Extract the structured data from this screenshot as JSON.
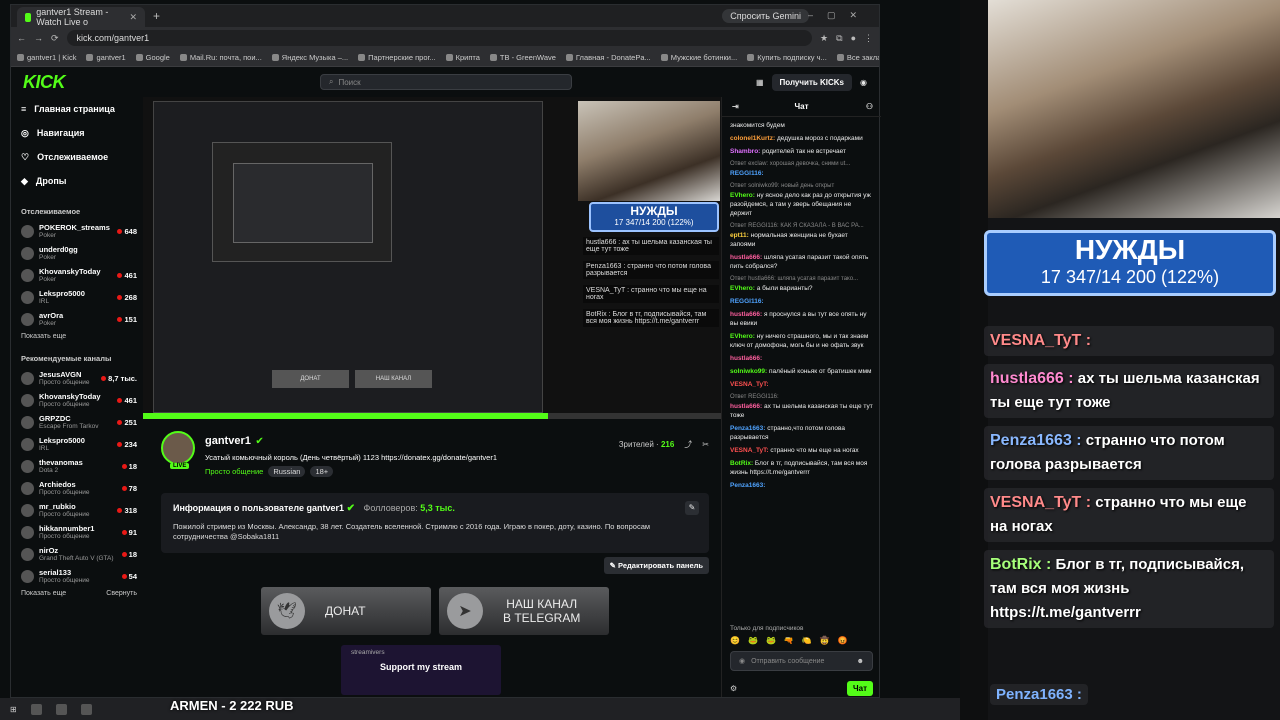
{
  "browser": {
    "tab_title": "gantver1 Stream - Watch Live o",
    "new_tab": "+",
    "gemini": "Спросить Gemini",
    "url": "kick.com/gantver1",
    "bookmarks": [
      "gantver1 | Kick",
      "gantver1",
      "Google",
      "Mail.Ru: почта, пои...",
      "Яндекс Музыка –...",
      "Партнерские прог...",
      "Крипта",
      "TB - GreenWave",
      "Главная - DonatePa...",
      "Мужские ботинки...",
      "Купить подписку ч...",
      "Все закладки"
    ]
  },
  "header": {
    "logo": "KICK",
    "search_placeholder": "Поиск",
    "get_kicks": "Получить KICKs"
  },
  "sidebar": {
    "nav": [
      {
        "label": "Главная страница",
        "icon": "hamburger-icon"
      },
      {
        "label": "Навигация",
        "icon": "compass-icon"
      },
      {
        "label": "Отслеживаемое",
        "icon": "heart-icon"
      },
      {
        "label": "Дропы",
        "icon": "drops-icon"
      }
    ],
    "following_title": "Отслеживаемое",
    "following": [
      {
        "name": "POKEROK_streams",
        "cat": "Poker",
        "viewers": "648"
      },
      {
        "name": "underd0gg",
        "cat": "Poker",
        "viewers": ""
      },
      {
        "name": "KhovanskyToday",
        "cat": "Poker",
        "viewers": "461"
      },
      {
        "name": "Lekspro5000",
        "cat": "IRL",
        "viewers": "268"
      },
      {
        "name": "avrOra",
        "cat": "Poker",
        "viewers": "151"
      }
    ],
    "show_more_1": "Показать еще",
    "recommended_title": "Рекомендуемые каналы",
    "recommended": [
      {
        "name": "JesusAVGN",
        "cat": "Просто общение",
        "viewers": "8,7 тыс."
      },
      {
        "name": "KhovanskyToday",
        "cat": "Просто общение",
        "viewers": "461"
      },
      {
        "name": "GRPZDC",
        "cat": "Escape From Tarkov",
        "viewers": "251"
      },
      {
        "name": "Lekspro5000",
        "cat": "IRL",
        "viewers": "234"
      },
      {
        "name": "thevanomas",
        "cat": "Dota 2",
        "viewers": "18"
      },
      {
        "name": "Archiedos",
        "cat": "Просто общение",
        "viewers": "78"
      },
      {
        "name": "mr_rubkio",
        "cat": "Просто общение",
        "viewers": "318"
      },
      {
        "name": "hikkannumber1",
        "cat": "Просто общение",
        "viewers": "91"
      },
      {
        "name": "nirOz",
        "cat": "Grand Theft Auto V (GTA)",
        "viewers": "18"
      },
      {
        "name": "serial133",
        "cat": "Просто общение",
        "viewers": "54"
      }
    ],
    "show_more_2": "Показать еще",
    "collapse": "Свернуть"
  },
  "player": {
    "needs_title": "НУЖДЫ",
    "needs_progress": "17 347/14 200 (122%)",
    "progress_fraction": 0.7,
    "mini_chat": [
      "hustla666 : ах ты шельма казанская ты еще тут тоже",
      "Penza1663 : странно что потом голова разрывается",
      "VESNA_TyT : странно что мы еще на ногах",
      "BotRix : Блог в тг, подписывайся, там вся моя жизнь https://t.me/gantverrr"
    ]
  },
  "stream": {
    "name": "gantver1",
    "live": "LIVE",
    "title": "Усатый комьючный король (День четвёртый) 1123 https://donatex.gg/donate/gantver1",
    "category": "Просто общение",
    "tags": [
      "Russian",
      "18+"
    ],
    "viewers_label": "Зрителей ·",
    "viewers": "216"
  },
  "about": {
    "heading": "Информация о пользователе gantver1",
    "followers_label": "Фолловеров:",
    "followers": "5,3 тыс.",
    "description": "Пожилой стример из Москвы. Александр, 38 лет. Создатель вселенной. Стримлю с 2016 года. Играю в покер, доту, казино. По вопросам сотрудничества @Sobaka1811",
    "edit_panel": "Редактировать панель"
  },
  "panels": {
    "donate": "ДОНАТ",
    "telegram_1": "НАШ КАНАЛ",
    "telegram_2": "В TELEGRAM",
    "streamivs": "streamivers",
    "support": "Support my stream"
  },
  "chat": {
    "title": "Чат",
    "messages": [
      {
        "user": "",
        "color": "#ccc",
        "text": "знакомится будем"
      },
      {
        "user": "colonel1Kurtz:",
        "color": "#ff9f3a",
        "text": "дедушка мороз с подарками"
      },
      {
        "user": "Shambro:",
        "color": "#e070ff",
        "text": "родителей так не встречает"
      },
      {
        "user": "REGGI116:",
        "color": "#4fa3ff",
        "text": "",
        "reply": "Ответ exclaw: хорошая девочка, сними ut..."
      },
      {
        "user": "EVhero:",
        "color": "#53fc18",
        "text": "ну ясное дело как раз до открытия уж разойдемся, а там у зверь обещания не держит",
        "reply": "Ответ solniwko99: новый день открыт"
      },
      {
        "user": "ept11:",
        "color": "#ffd23f",
        "text": "нормальная женщина не бухает запоями",
        "reply": "Ответ REGGI116: КАК Я СКАЗАЛА - В ВАС РА..."
      },
      {
        "user": "hustla666:",
        "color": "#ff5f9f",
        "text": "шляпа усатая паразит такой опять пить собрался?"
      },
      {
        "user": "EVhero:",
        "color": "#53fc18",
        "text": "а были варианты?",
        "reply": "Ответ hustla666: шляпа усатая паразит тако..."
      },
      {
        "user": "REGGI116:",
        "color": "#4fa3ff",
        "text": ""
      },
      {
        "user": "hustla666:",
        "color": "#ff5f9f",
        "text": "я проснулся а вы тут все опять ну вы евики"
      },
      {
        "user": "EVhero:",
        "color": "#53fc18",
        "text": "ну ничего страшного, мы и так знаем ключ от домофона, могь бы и не офать звук"
      },
      {
        "user": "hustla666:",
        "color": "#ff5f9f",
        "text": ""
      },
      {
        "user": "solniwko99:",
        "color": "#53fc18",
        "text": "палёный коньяк от братишек ммм"
      },
      {
        "user": "VESNA_TyT:",
        "color": "#ff5050",
        "text": ""
      },
      {
        "user": "hustla666:",
        "color": "#ff5f9f",
        "text": "ах ты шельма казанская ты еще тут тоже",
        "reply": "Ответ REGGI116:"
      },
      {
        "user": "Penza1663:",
        "color": "#4fa3ff",
        "text": "странно,что потом голова разрывается"
      },
      {
        "user": "VESNA_TyT:",
        "color": "#ff5050",
        "text": "странно что мы еще на ногах"
      },
      {
        "user": "BotRix:",
        "color": "#53fc18",
        "text": "Блог в тг, подписывайся, там вся моя жизнь https://t.me/gantverrr"
      },
      {
        "user": "Penza1663:",
        "color": "#4fa3ff",
        "text": ""
      }
    ],
    "subs_only": "Только для подписчиков",
    "input_placeholder": "Отправить сообщение",
    "chat_button": "Чат"
  },
  "overlay": {
    "needs_title": "НУЖДЫ",
    "needs_progress": "17 347/14 200 (122%)",
    "lines": [
      {
        "user": "VESNA_TyT :",
        "color": "#ff8a8a",
        "text": ""
      },
      {
        "user": "hustla666 :",
        "color": "#ff8ad0",
        "text": "ах ты шельма казанская ты еще тут тоже"
      },
      {
        "user": "Penza1663 :",
        "color": "#8ab8ff",
        "text": "странно что потом голова разрывается"
      },
      {
        "user": "VESNA_TyT :",
        "color": "#ff8a8a",
        "text": "странно что мы еще на ногах"
      },
      {
        "user": "BotRix :",
        "color": "#a6ff7a",
        "text": "Блог в тг, подписывайся, там вся моя жизнь https://t.me/gantverrr"
      }
    ],
    "last_user": "Penza1663 :"
  },
  "taskbar": {
    "armen": "ARMEN - 2 222 RUB"
  }
}
